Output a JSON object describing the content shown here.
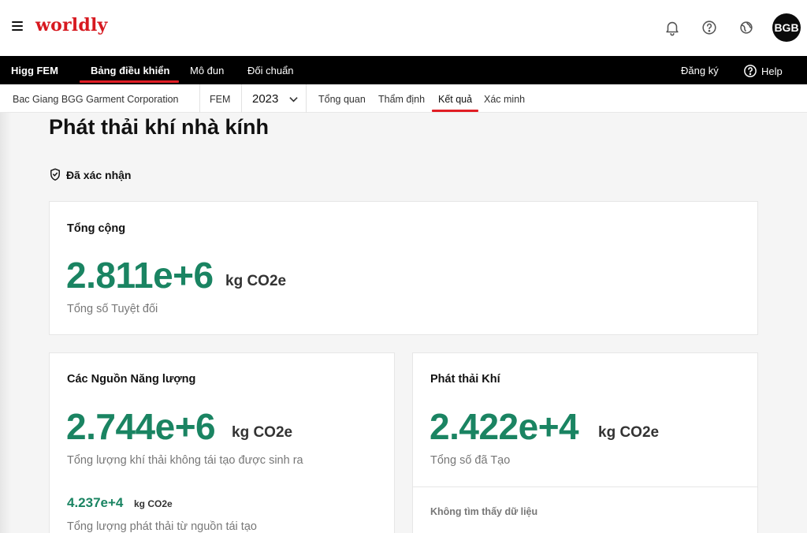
{
  "header": {
    "logo": "worldly",
    "avatar_initials": "BGB",
    "icons": [
      "hamburger-icon",
      "bell-icon",
      "help-circle-icon",
      "globe-icon"
    ]
  },
  "mainnav": {
    "brand": "Higg FEM",
    "items": [
      {
        "label": "Bảng điều khiển",
        "active": true
      },
      {
        "label": "Mô đun",
        "active": false
      },
      {
        "label": "Đối chuẩn",
        "active": false
      }
    ],
    "signup_label": "Đăng ký",
    "help_label": "Help"
  },
  "subnav": {
    "organization": "Bac Giang BGG Garment Corporation",
    "module": "FEM",
    "year": "2023",
    "tabs": [
      {
        "label": "Tổng quan",
        "active": false
      },
      {
        "label": "Thẩm định",
        "active": false
      },
      {
        "label": "Kết quả",
        "active": true
      },
      {
        "label": "Xác minh",
        "active": false
      }
    ]
  },
  "page": {
    "title": "Phát thải khí nhà kính",
    "status": "Đã xác nhận"
  },
  "cards": {
    "total": {
      "title": "Tổng cộng",
      "value": "2.811e+6",
      "unit": "kg CO2e",
      "caption": "Tổng số Tuyệt đối"
    },
    "energy": {
      "title": "Các Nguồn Năng lượng",
      "value": "2.744e+6",
      "unit": "kg CO2e",
      "caption": "Tổng lượng khí thải không tái tạo được sinh ra",
      "renewable_value": "4.237e+4",
      "renewable_unit": "kg CO2e",
      "renewable_caption": "Tổng lượng phát thải từ nguồn tái tạo"
    },
    "gas": {
      "title": "Phát thải Khí",
      "value": "2.422e+4",
      "unit": "kg CO2e",
      "caption": "Tổng số đã Tạo",
      "empty_message": "Không tìm thấy dữ liệu"
    }
  },
  "colors": {
    "brand_red": "#d71920",
    "accent_green": "#1a8462",
    "nav_black": "#000000"
  }
}
